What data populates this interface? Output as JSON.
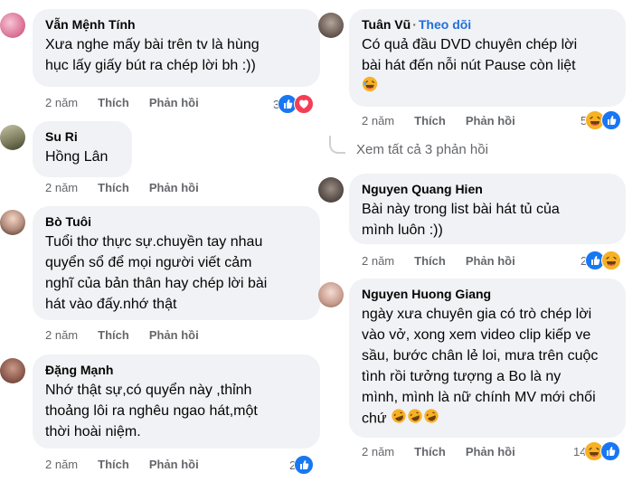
{
  "left": [
    {
      "author": "Vẫn Mệnh Tính",
      "lines": [
        "Xưa nghe mấy bài trên tv là hùng",
        "hục lấy giấy bút ra chép lời bh :))"
      ],
      "time": "2 năm",
      "like": "Thích",
      "reply": "Phản hồi",
      "reactions": {
        "count": "3",
        "icons": [
          "like-icon",
          "love-icon"
        ]
      }
    },
    {
      "author": "Su Ri",
      "lines": [
        "Hồng Lân"
      ],
      "time": "2 năm",
      "like": "Thích",
      "reply": "Phản hồi"
    },
    {
      "author": "Bò Tuôi",
      "lines": [
        "Tuổi thơ thực sự.chuyền tay nhau",
        "quyển sổ để mọi người viết cảm",
        "nghĩ của bản thân hay chép lời bài",
        "hát vào đấy.nhớ thật"
      ],
      "time": "2 năm",
      "like": "Thích",
      "reply": "Phản hồi"
    },
    {
      "author": "Đặng Mạnh",
      "lines": [
        "Nhớ thật sự,có quyển này ,thỉnh",
        "thoảng lôi ra nghêu ngao hát,một",
        "thời hoài niệm."
      ],
      "time": "2 năm",
      "like": "Thích",
      "reply": "Phản hồi",
      "reactions": {
        "count": "2",
        "icons": [
          "like-icon"
        ]
      }
    }
  ],
  "right": [
    {
      "author": "Tuân Vũ",
      "follow": "Theo dõi",
      "lines": [
        "Có quả đầu DVD chuyên chép lời",
        "bài hát đến nỗi nút Pause còn liệt"
      ],
      "time": "2 năm",
      "like": "Thích",
      "reply": "Phản hồi",
      "reactions": {
        "count": "5",
        "icons": [
          "haha-icon",
          "like-icon"
        ]
      }
    },
    {
      "view_replies": "Xem tất cả 3 phản hồi"
    },
    {
      "author": "Nguyen Quang Hien",
      "lines": [
        "Bài này trong list bài hát tủ của",
        "mình luôn :))"
      ],
      "time": "2 năm",
      "like": "Thích",
      "reply": "Phản hồi",
      "reactions": {
        "count": "2",
        "icons": [
          "like-icon",
          "haha-icon"
        ]
      }
    },
    {
      "author": "Nguyen Huong Giang",
      "lines": [
        "ngày xưa chuyên gia có trò chép lời",
        "vào vở, xong xem video clip kiếp ve",
        "sầu, bước chân lẻ loi, mưa trên cuộc",
        "tình rồi tưởng tượng a Bo là ny",
        "mình, mình là nữ chính MV mới chối",
        "chứ"
      ],
      "time": "2 năm",
      "like": "Thích",
      "reply": "Phản hồi",
      "reactions": {
        "count": "14",
        "icons": [
          "haha-icon",
          "like-icon"
        ]
      }
    }
  ],
  "colors": {
    "bubble": "#f0f2f5",
    "like": "#1877f2",
    "love": "#f33e58",
    "haha": "#f7b125",
    "meta": "#65676b",
    "follow": "#216fdb"
  }
}
